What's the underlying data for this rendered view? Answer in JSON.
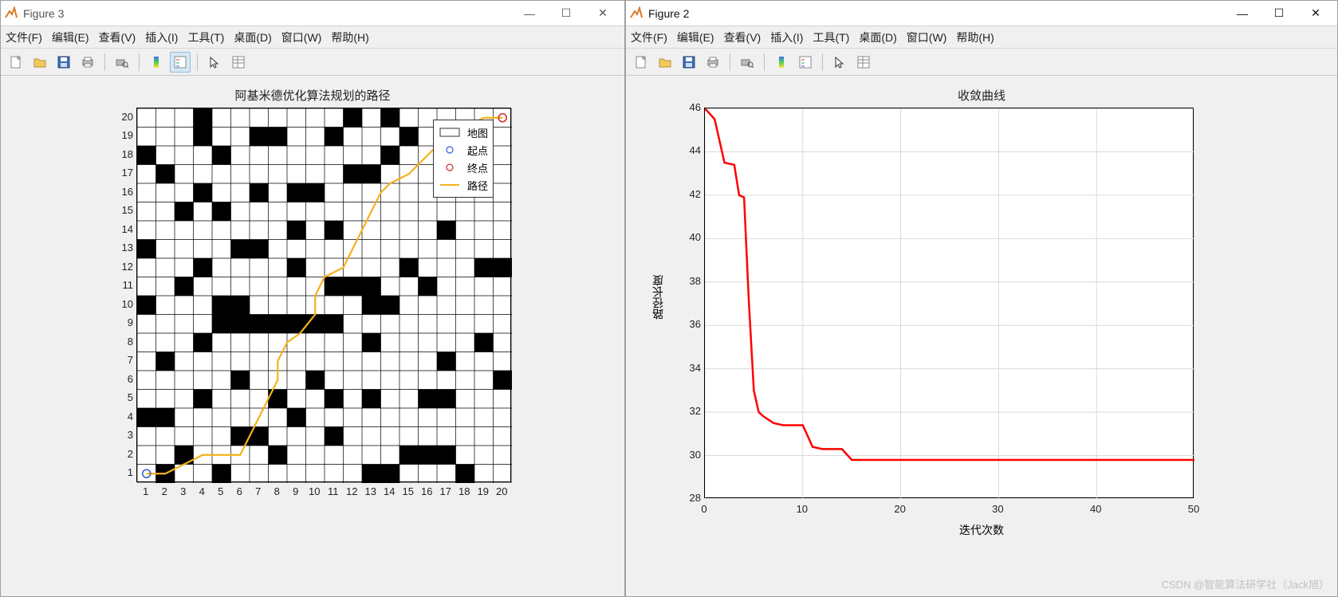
{
  "windows": {
    "left": {
      "title": "Figure 3"
    },
    "right": {
      "title": "Figure 2"
    }
  },
  "menubar": {
    "file": "文件(F)",
    "edit": "编辑(E)",
    "view": "查看(V)",
    "insert": "插入(I)",
    "tools": "工具(T)",
    "desktop": "桌面(D)",
    "window": "窗口(W)",
    "help": "帮助(H)"
  },
  "left_chart": {
    "title": "阿基米德优化算法规划的路径",
    "x_ticks": [
      "1",
      "2",
      "3",
      "4",
      "5",
      "6",
      "7",
      "8",
      "9",
      "10",
      "11",
      "12",
      "13",
      "14",
      "15",
      "16",
      "17",
      "18",
      "19",
      "20"
    ],
    "y_ticks": [
      "1",
      "2",
      "3",
      "4",
      "5",
      "6",
      "7",
      "8",
      "9",
      "10",
      "11",
      "12",
      "13",
      "14",
      "15",
      "16",
      "17",
      "18",
      "19",
      "20"
    ],
    "legend": {
      "map": "地图",
      "start": "起点",
      "end": "终点",
      "path": "路径"
    }
  },
  "right_chart": {
    "title": "收敛曲线",
    "xlabel": "迭代次数",
    "ylabel": "路径长度",
    "x_ticks": [
      "0",
      "10",
      "20",
      "30",
      "40",
      "50"
    ],
    "y_ticks": [
      "28",
      "30",
      "32",
      "34",
      "36",
      "38",
      "40",
      "42",
      "44",
      "46"
    ]
  },
  "watermark": "CSDN @智能算法研学社（Jack旭）",
  "chart_data": [
    {
      "type": "heatmap",
      "title": "阿基米德优化算法规划的路径",
      "grid_size": 20,
      "obstacles": [
        [
          2,
          1
        ],
        [
          5,
          1
        ],
        [
          13,
          1
        ],
        [
          14,
          1
        ],
        [
          18,
          1
        ],
        [
          3,
          2
        ],
        [
          8,
          2
        ],
        [
          15,
          2
        ],
        [
          16,
          2
        ],
        [
          17,
          2
        ],
        [
          6,
          3
        ],
        [
          7,
          3
        ],
        [
          11,
          3
        ],
        [
          1,
          4
        ],
        [
          2,
          4
        ],
        [
          9,
          4
        ],
        [
          4,
          5
        ],
        [
          8,
          5
        ],
        [
          11,
          5
        ],
        [
          13,
          5
        ],
        [
          16,
          5
        ],
        [
          17,
          5
        ],
        [
          6,
          6
        ],
        [
          10,
          6
        ],
        [
          20,
          6
        ],
        [
          2,
          7
        ],
        [
          17,
          7
        ],
        [
          4,
          8
        ],
        [
          13,
          8
        ],
        [
          19,
          8
        ],
        [
          5,
          9
        ],
        [
          6,
          9
        ],
        [
          7,
          9
        ],
        [
          8,
          9
        ],
        [
          9,
          9
        ],
        [
          10,
          9
        ],
        [
          11,
          9
        ],
        [
          1,
          10
        ],
        [
          5,
          10
        ],
        [
          6,
          10
        ],
        [
          13,
          10
        ],
        [
          14,
          10
        ],
        [
          3,
          11
        ],
        [
          11,
          11
        ],
        [
          12,
          11
        ],
        [
          13,
          11
        ],
        [
          16,
          11
        ],
        [
          4,
          12
        ],
        [
          9,
          12
        ],
        [
          15,
          12
        ],
        [
          19,
          12
        ],
        [
          20,
          12
        ],
        [
          1,
          13
        ],
        [
          6,
          13
        ],
        [
          7,
          13
        ],
        [
          9,
          14
        ],
        [
          11,
          14
        ],
        [
          17,
          14
        ],
        [
          3,
          15
        ],
        [
          5,
          15
        ],
        [
          4,
          16
        ],
        [
          7,
          16
        ],
        [
          9,
          16
        ],
        [
          10,
          16
        ],
        [
          2,
          17
        ],
        [
          12,
          17
        ],
        [
          13,
          17
        ],
        [
          17,
          17
        ],
        [
          18,
          17
        ],
        [
          19,
          17
        ],
        [
          1,
          18
        ],
        [
          5,
          18
        ],
        [
          14,
          18
        ],
        [
          4,
          19
        ],
        [
          7,
          19
        ],
        [
          8,
          19
        ],
        [
          11,
          19
        ],
        [
          15,
          19
        ],
        [
          4,
          20
        ],
        [
          12,
          20
        ],
        [
          14,
          20
        ]
      ],
      "start": [
        1,
        1
      ],
      "end": [
        20,
        20
      ],
      "path": [
        [
          1,
          1
        ],
        [
          2,
          1
        ],
        [
          3,
          1.5
        ],
        [
          4,
          2
        ],
        [
          5,
          2
        ],
        [
          6,
          2
        ],
        [
          6.5,
          3
        ],
        [
          7,
          4
        ],
        [
          7.5,
          5
        ],
        [
          8,
          6
        ],
        [
          8,
          7
        ],
        [
          8.5,
          8
        ],
        [
          9.2,
          8.5
        ],
        [
          10,
          9.5
        ],
        [
          10,
          10.5
        ],
        [
          10.5,
          11.5
        ],
        [
          11.5,
          12
        ],
        [
          12,
          13
        ],
        [
          12.5,
          14
        ],
        [
          13,
          15
        ],
        [
          13.5,
          16
        ],
        [
          14,
          16.5
        ],
        [
          15,
          17
        ],
        [
          16,
          18
        ],
        [
          17,
          19
        ],
        [
          18,
          19.5
        ],
        [
          19,
          20
        ],
        [
          20,
          20
        ]
      ],
      "legend": [
        "地图",
        "起点",
        "终点",
        "路径"
      ]
    },
    {
      "type": "line",
      "title": "收敛曲线",
      "xlabel": "迭代次数",
      "ylabel": "路径长度",
      "xlim": [
        0,
        50
      ],
      "ylim": [
        28,
        46
      ],
      "series": [
        {
          "name": "路径长度",
          "color": "#ff0000",
          "x": [
            0,
            1,
            2,
            3,
            3.5,
            4,
            4.5,
            5,
            5.5,
            6,
            7,
            8,
            9,
            10,
            11,
            12,
            13,
            14,
            15,
            20,
            30,
            40,
            50
          ],
          "y": [
            46,
            45.5,
            43.5,
            43.4,
            42,
            41.9,
            37,
            33,
            32,
            31.8,
            31.5,
            31.4,
            31.4,
            31.4,
            30.4,
            30.3,
            30.3,
            30.3,
            29.8,
            29.8,
            29.8,
            29.8,
            29.8
          ]
        }
      ]
    }
  ]
}
